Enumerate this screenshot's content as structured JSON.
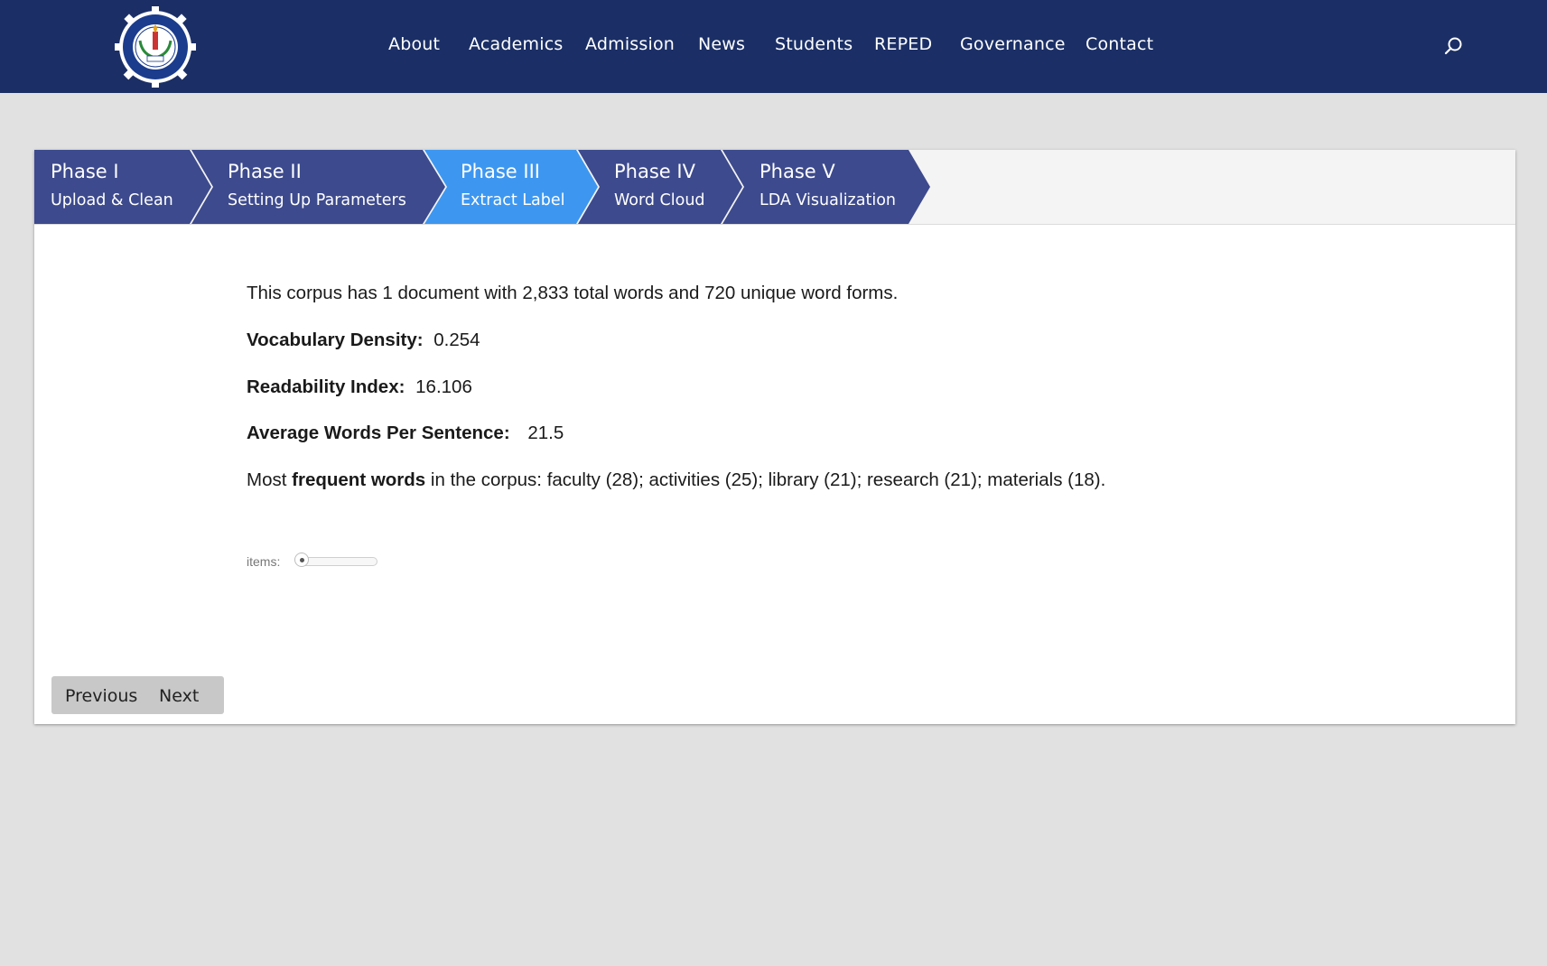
{
  "header": {
    "nav": [
      "About",
      "Academics",
      "Admission",
      "News",
      "Students",
      "REPED",
      "Governance",
      "Contact"
    ],
    "logo_icon": "seal-logo",
    "search_icon": "search-icon",
    "bg_color": "#1b2f66"
  },
  "steps": [
    {
      "title": "Phase I",
      "subtitle": "Upload & Clean",
      "active": false
    },
    {
      "title": "Phase II",
      "subtitle": "Setting Up Parameters",
      "active": false
    },
    {
      "title": "Phase III",
      "subtitle": "Extract Label",
      "active": true
    },
    {
      "title": "Phase IV",
      "subtitle": "Word Cloud",
      "active": false
    },
    {
      "title": "Phase V",
      "subtitle": "LDA Visualization",
      "active": false
    }
  ],
  "step_colors": {
    "normal": "#3d4a8d",
    "active": "#3d97f0"
  },
  "summary": {
    "intro": "This corpus has 1 document with 2,833 total words and 720 unique word forms.",
    "density_label": "Vocabulary Density:",
    "density_value": "0.254",
    "readability_label": "Readability Index:",
    "readability_value": "16.106",
    "avg_label": "Average Words Per Sentence:",
    "avg_value": "21.5",
    "freq_prefix": "Most",
    "freq_bold": "frequent words",
    "freq_suffix": "in the corpus: faculty (28); activities (25); library (21); research (21); materials (18)."
  },
  "slider": {
    "label": "items:",
    "level": 0
  },
  "pager": {
    "previous": "Previous",
    "next": "Next"
  }
}
